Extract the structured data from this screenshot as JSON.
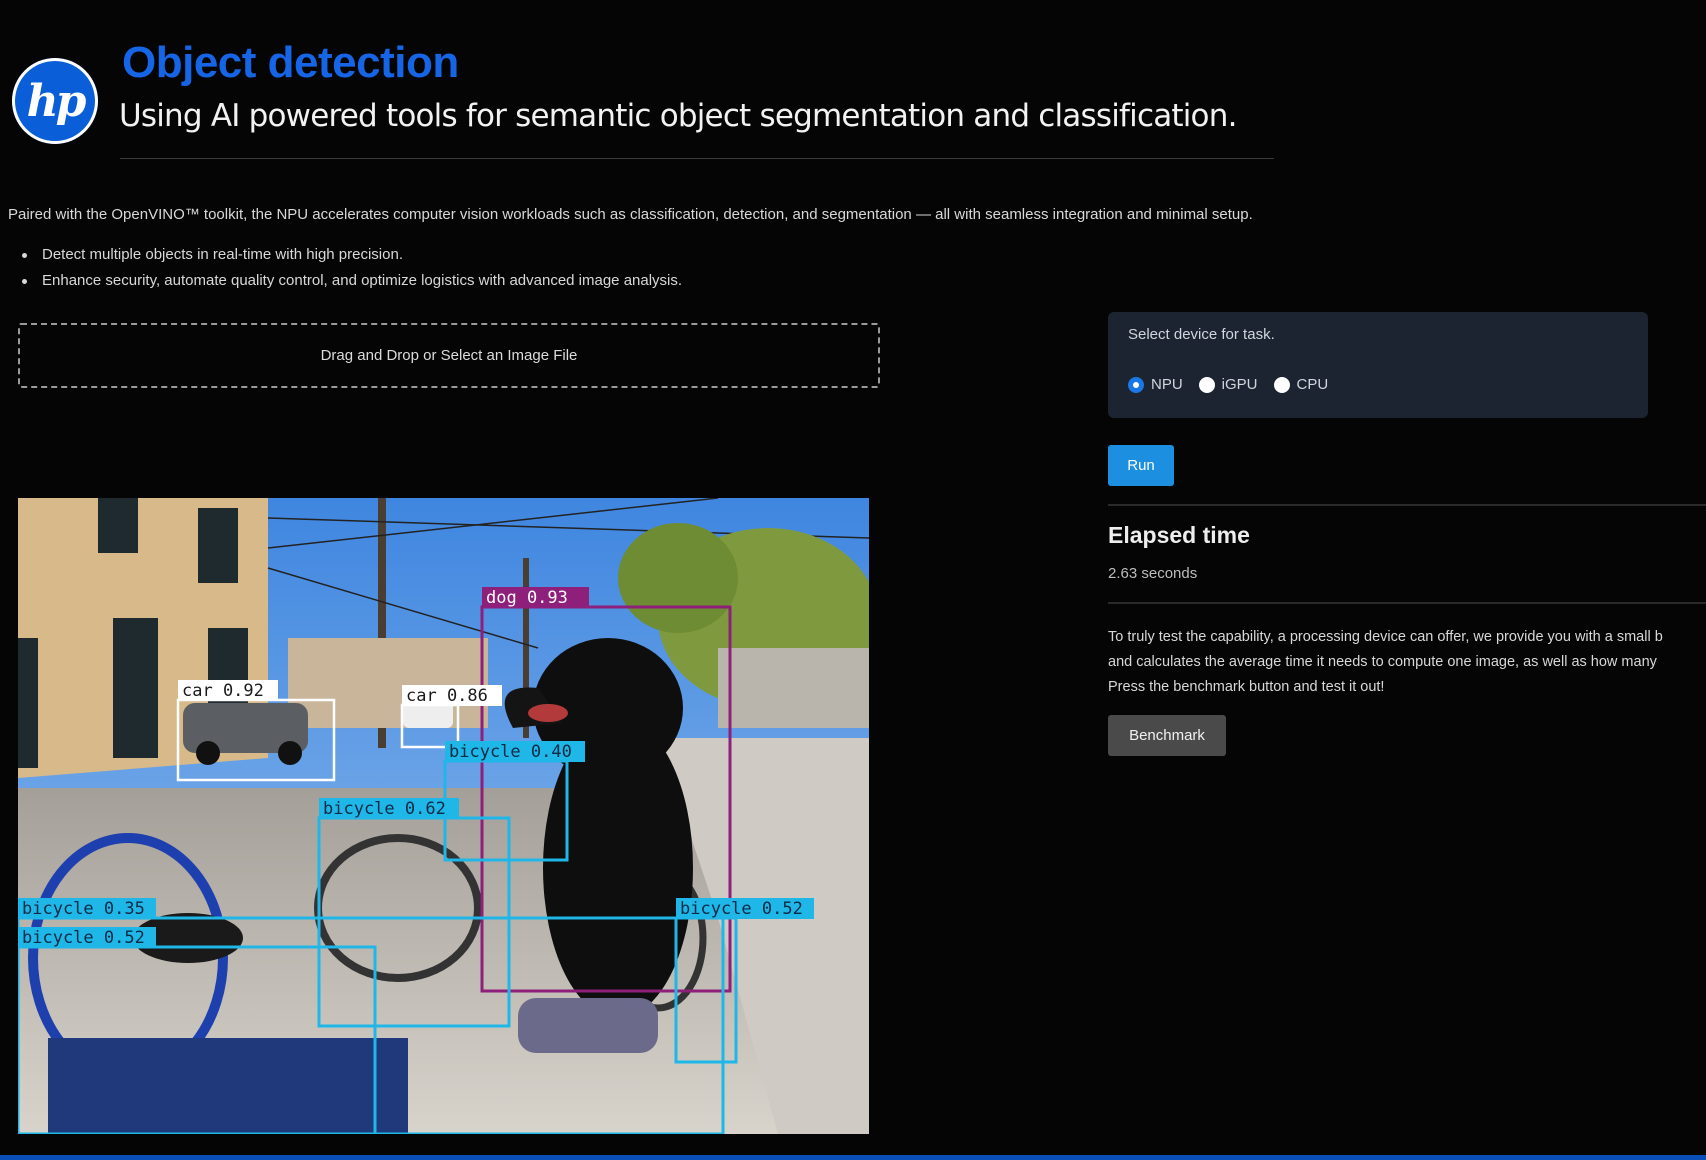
{
  "header": {
    "logo_text": "hp",
    "title": "Object detection",
    "subtitle": "Using AI powered tools for semantic object segmentation and classification."
  },
  "intro": {
    "text": "Paired with the OpenVINO™ toolkit, the NPU accelerates computer vision workloads such as classification, detection, and segmentation — all with seamless integration and minimal setup.",
    "bullets": [
      "Detect multiple objects in real-time with high precision.",
      "Enhance security, automate quality control, and optimize logistics with advanced image analysis."
    ]
  },
  "upload": {
    "label": "Drag and Drop or Select an Image File"
  },
  "detections": [
    {
      "label": "dog 0.93",
      "class": "dog",
      "score": 0.93
    },
    {
      "label": "car 0.92",
      "class": "car",
      "score": 0.92
    },
    {
      "label": "car 0.86",
      "class": "car",
      "score": 0.86
    },
    {
      "label": "bicycle 0.40",
      "class": "bicycle",
      "score": 0.4
    },
    {
      "label": "bicycle 0.62",
      "class": "bicycle",
      "score": 0.62
    },
    {
      "label": "bicycle 0.35",
      "class": "bicycle",
      "score": 0.35
    },
    {
      "label": "bicycle 0.52",
      "class": "bicycle",
      "score": 0.52
    },
    {
      "label": "bicycle 0.52",
      "class": "bicycle",
      "score": 0.52
    }
  ],
  "device": {
    "label": "Select device for task.",
    "options": [
      "NPU",
      "iGPU",
      "CPU"
    ],
    "selected": "NPU"
  },
  "run_label": "Run",
  "elapsed": {
    "heading": "Elapsed time",
    "value": "2.63 seconds"
  },
  "benchmark": {
    "lines": [
      "To truly test the capability, a processing device can offer, we provide you with a small b",
      "and calculates the average time it needs to compute one image, as well as how many",
      "Press the benchmark button and test it out!"
    ],
    "button_label": "Benchmark"
  },
  "colors": {
    "title": "#1565e6",
    "logo": "#0a5fd8",
    "run_button": "#1d8fe0",
    "dog_box": "#8e1f7a",
    "car_box": "#ffffff",
    "bicycle_box": "#1fb6e8"
  }
}
